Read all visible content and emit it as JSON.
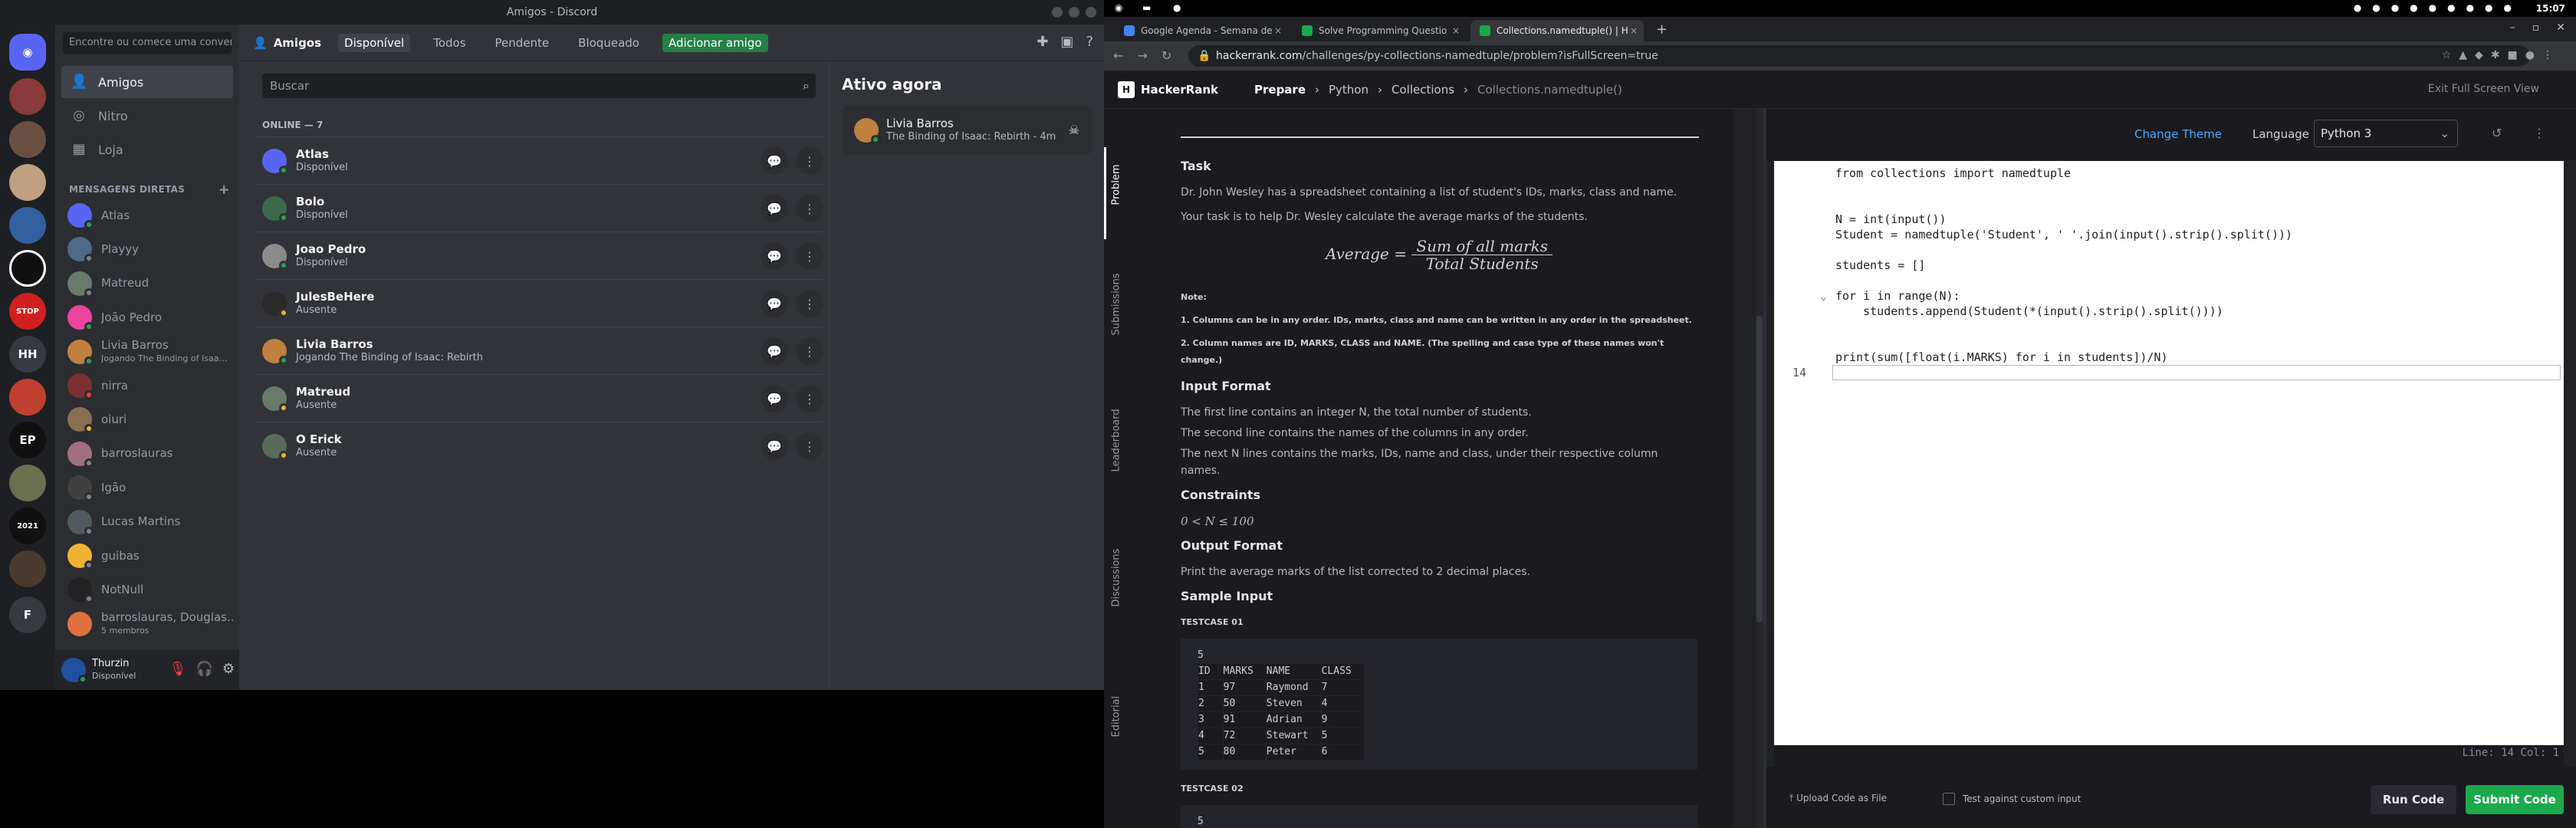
{
  "discord": {
    "window_title": "Amigos - Discord",
    "search_placeholder": "Encontre ou comece uma conver...",
    "nav": [
      "Amigos",
      "Nitro",
      "Loja"
    ],
    "dm_header": "MENSAGENS DIRETAS",
    "dms": [
      {
        "name": "Atlas",
        "sub": "",
        "color": "#5865f2",
        "status": "on"
      },
      {
        "name": "Playyy",
        "sub": "",
        "color": "#4e6a8a",
        "status": "off"
      },
      {
        "name": "Matreud",
        "sub": "",
        "color": "#6a7a6a",
        "status": "off"
      },
      {
        "name": "João Pedro",
        "sub": "",
        "color": "#eb459e",
        "status": "on"
      },
      {
        "name": "Livia Barros",
        "sub": "Jogando The Binding of Isaac:...",
        "color": "#c08040",
        "status": "on"
      },
      {
        "name": "nirra",
        "sub": "",
        "color": "#7a3030",
        "status": "dnd"
      },
      {
        "name": "oiuri",
        "sub": "",
        "color": "#8a7050",
        "status": "idle"
      },
      {
        "name": "barroslauras",
        "sub": "",
        "color": "#a07080",
        "status": "off"
      },
      {
        "name": "Igão",
        "sub": "",
        "color": "#404040",
        "status": "off"
      },
      {
        "name": "Lucas Martins",
        "sub": "",
        "color": "#505a60",
        "status": "off"
      },
      {
        "name": "guibas",
        "sub": "",
        "color": "#f0b232",
        "status": "off"
      },
      {
        "name": "NotNull",
        "sub": "",
        "color": "#222222",
        "status": "off"
      },
      {
        "name": "barroslauras, Douglas...",
        "sub": "5 membros",
        "color": "#e07040",
        "status": ""
      }
    ],
    "user": {
      "name": "Thurzin",
      "status": "Disponível"
    },
    "top_title": "Amigos",
    "tabs": [
      "Disponível",
      "Todos",
      "Pendente",
      "Bloqueado",
      "Adicionar amigo"
    ],
    "friend_search_placeholder": "Buscar",
    "online_label": "ONLINE — 7",
    "friends": [
      {
        "name": "Atlas",
        "status_text": "Disponível",
        "color": "#5865f2",
        "status": "on"
      },
      {
        "name": "Bolo",
        "status_text": "Disponível",
        "color": "#3a6a4a",
        "status": "on"
      },
      {
        "name": "Joao Pedro",
        "status_text": "Disponível",
        "color": "#8a8a8a",
        "status": "on"
      },
      {
        "name": "JulesBeHere",
        "status_text": "Ausente",
        "color": "#2a2a2a",
        "status": "idle"
      },
      {
        "name": "Livia Barros",
        "status_text": "Jogando The Binding of Isaac: Rebirth",
        "color": "#c08040",
        "status": "on"
      },
      {
        "name": "Matreud",
        "status_text": "Ausente",
        "color": "#6a7a6a",
        "status": "idle"
      },
      {
        "name": "O Erick",
        "status_text": "Ausente",
        "color": "#5a6a5a",
        "status": "idle"
      }
    ],
    "active_now_title": "Ativo agora",
    "active_card": {
      "name": "Livia Barros",
      "activity": "The Binding of Isaac: Rebirth - 4m"
    }
  },
  "os": {
    "time": "15:07"
  },
  "chrome": {
    "tabs": [
      {
        "title": "Google Agenda - Semana de",
        "color": "#4285f4"
      },
      {
        "title": "Solve Programming Questio",
        "color": "#1ba94c"
      },
      {
        "title": "Collections.namedtuple() | H",
        "color": "#1ba94c"
      }
    ],
    "url_host": "hackerrank.com",
    "url_path": "/challenges/py-collections-namedtuple/problem?isFullScreen=true"
  },
  "hackerrank": {
    "brand": "HackerRank",
    "breadcrumb": [
      "Prepare",
      "Python",
      "Collections",
      "Collections.namedtuple()"
    ],
    "exit_label": "Exit Full Screen View",
    "side_tabs": [
      "Problem",
      "Submissions",
      "Leaderboard",
      "Discussions",
      "Editorial"
    ],
    "task_title": "Task",
    "task_text": "Dr. John Wesley has a spreadsheet containing a list of student's IDs, marks, class and name.",
    "task_text2": "Your task is to help Dr. Wesley calculate the average marks of the students.",
    "formula_left": "Average =",
    "formula_top": "Sum of all marks",
    "formula_bottom": "Total Students",
    "note_title": "Note:",
    "note1": "1. Columns can be in any order. IDs, marks, class and name can be written in any order in the spreadsheet.",
    "note2": "2. Column names are ID, MARKS, CLASS and NAME. (The spelling and case type of these names won't change.)",
    "input_title": "Input Format",
    "input1": "The first line contains an integer N, the total number of students.",
    "input2": "The second line contains the names of the columns in any order.",
    "input3": "The next N lines contains the marks, IDs, name and class, under their respective column names.",
    "constraints_title": "Constraints",
    "constraints": "0 < N ≤ 100",
    "output_title": "Output Format",
    "output_text": "Print the average marks of the list corrected to 2 decimal places.",
    "sample_title": "Sample Input",
    "tc1": "TESTCASE 01",
    "tc2": "TESTCASE 02",
    "sample_n": "5",
    "sample_header": [
      "ID",
      "MARKS",
      "NAME",
      "CLASS"
    ],
    "sample_rows": [
      [
        "1",
        "97",
        "Raymond",
        "7"
      ],
      [
        "2",
        "50",
        "Steven",
        "4"
      ],
      [
        "3",
        "91",
        "Adrian",
        "9"
      ],
      [
        "4",
        "72",
        "Stewart",
        "5"
      ],
      [
        "5",
        "80",
        "Peter",
        "6"
      ]
    ],
    "sample2_n": "5",
    "change_theme": "Change Theme",
    "language_label": "Language",
    "language": "Python 3",
    "code_lines": [
      "from collections import namedtuple",
      "",
      "",
      "N = int(input())",
      "Student = namedtuple('Student', ' '.join(input().strip().split()))",
      "",
      "students = []",
      "",
      "for i in range(N):",
      "    students.append(Student(*(input().strip().split())))",
      "",
      "",
      "print(sum([float(i.MARKS) for i in students])/N)",
      ""
    ],
    "current_line": "14",
    "status": "Line: 14 Col: 1",
    "upload_label": "Upload Code as File",
    "custom_input_label": "Test against custom input",
    "run_label": "Run Code",
    "submit_label": "Submit Code"
  }
}
